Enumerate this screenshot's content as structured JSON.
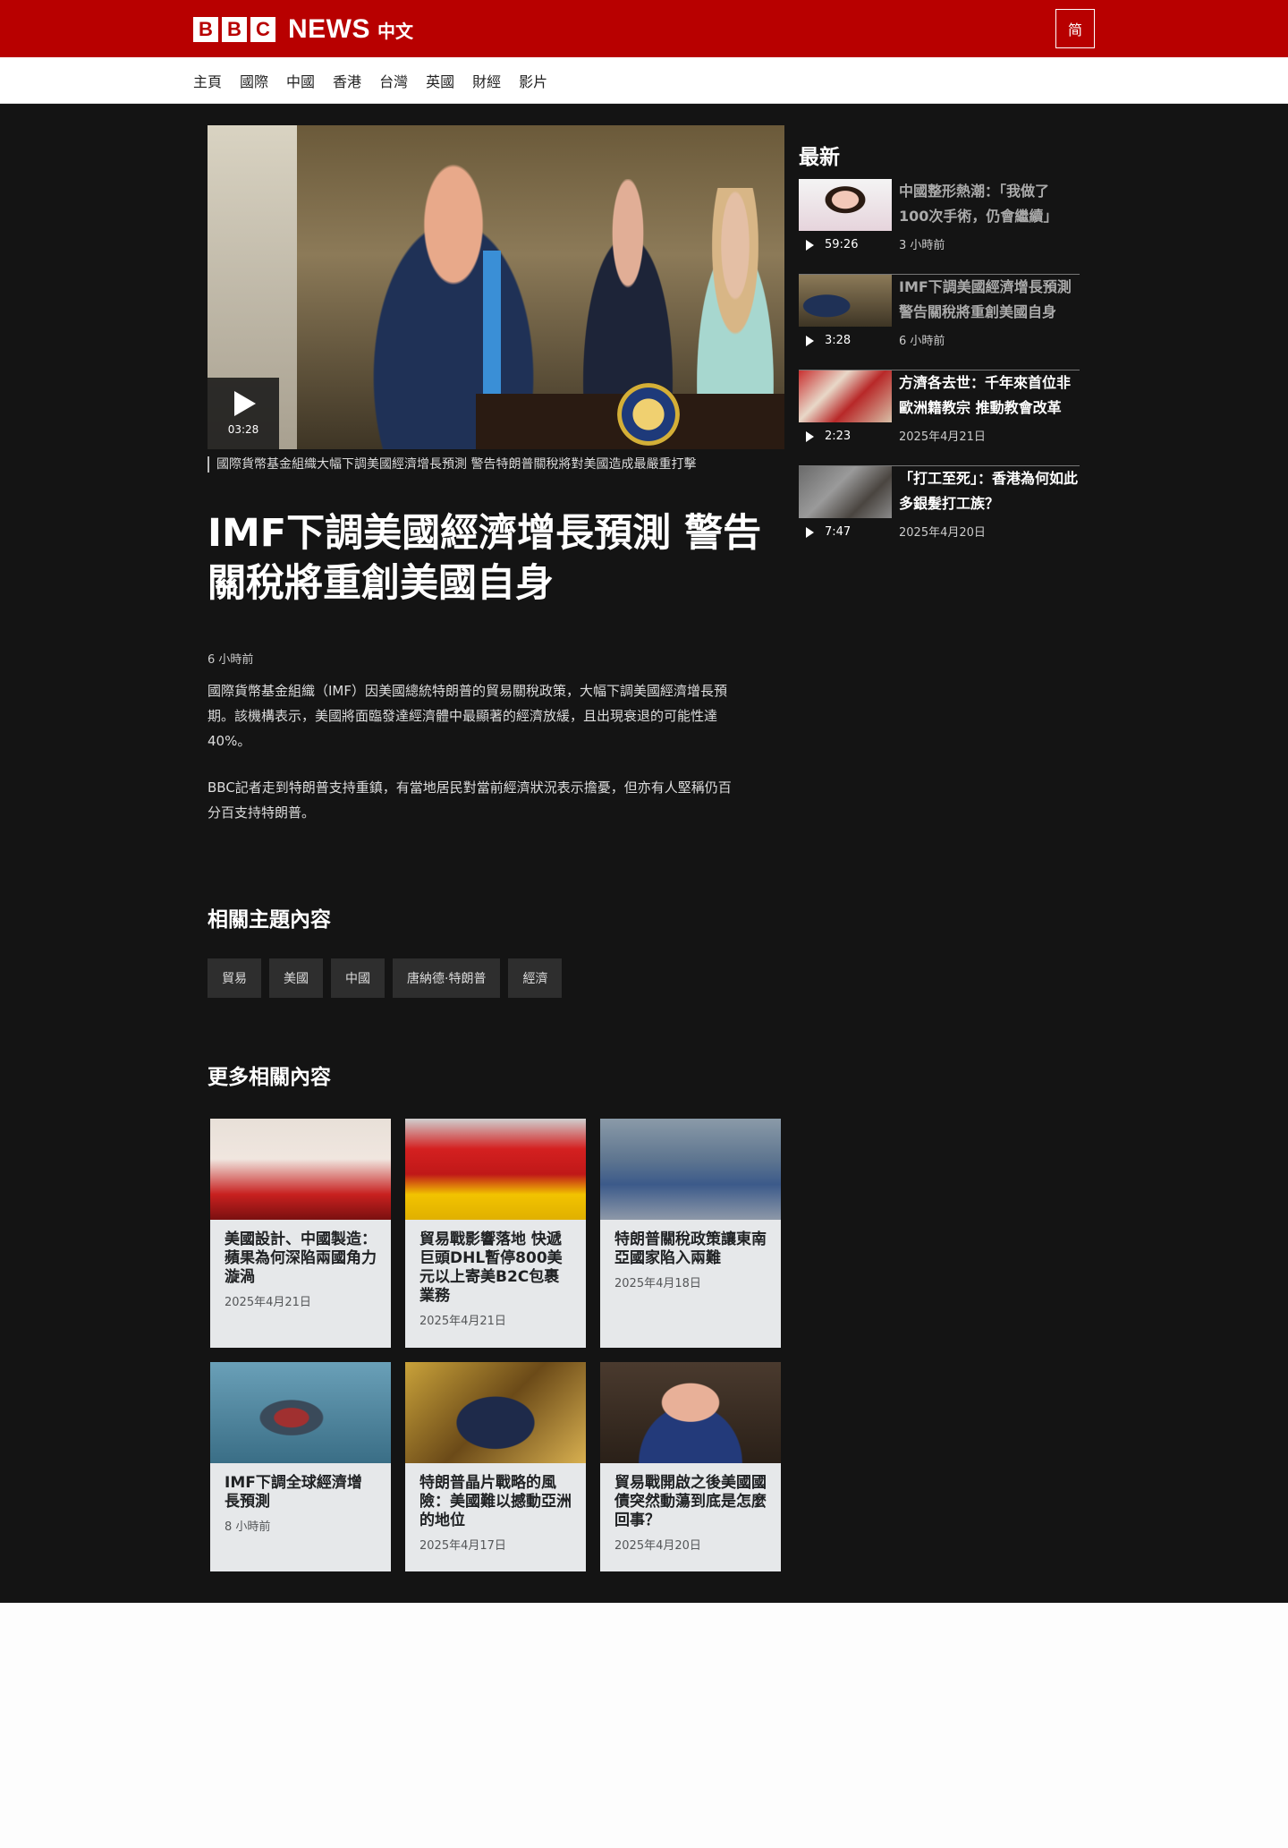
{
  "brand": {
    "logo_letters": [
      "B",
      "B",
      "C"
    ],
    "news_label": "NEWS",
    "lang_label": "中文",
    "script_toggle": "简",
    "color": "#b80000"
  },
  "nav": {
    "items": [
      "主頁",
      "國際",
      "中國",
      "香港",
      "台灣",
      "英國",
      "財經",
      "影片"
    ]
  },
  "hero": {
    "duration": "03:28",
    "caption": "國際貨幣基金組織大幅下調美國經濟增長預測 警告特朗普關稅將對美國造成最嚴重打擊",
    "icon": "play-icon"
  },
  "article": {
    "headline": "IMF下調美國經濟增長預測 警告關稅將重創美國自身",
    "timestamp": "6 小時前",
    "paragraph1": "國際貨幣基金組織（IMF）因美國總統特朗普的貿易關稅政策，大幅下調美國經濟增長預期。該機構表示，美國將面臨發達經濟體中最顯著的經濟放緩，且出現衰退的可能性達40%。",
    "paragraph2": "BBC記者走到特朗普支持重鎮，有當地居民對當前經濟狀況表示擔憂，但亦有人堅稱仍百分百支持特朗普。"
  },
  "related": {
    "title": "相關主題內容",
    "tags": [
      "貿易",
      "美國",
      "中國",
      "唐納德·特朗普",
      "經濟"
    ]
  },
  "more": {
    "title": "更多相關內容",
    "cards": [
      {
        "title": "美國設計、中國製造：蘋果為何深陷兩國角力漩渦",
        "date": "2025年4月21日"
      },
      {
        "title": "貿易戰影響落地 快遞巨頭DHL暫停800美元以上寄美B2C包裹業務",
        "date": "2025年4月21日"
      },
      {
        "title": "特朗普關稅政策讓東南亞國家陷入兩難",
        "date": "2025年4月18日"
      },
      {
        "title": "IMF下調全球經濟增長預測",
        "date": "8 小時前"
      },
      {
        "title": "特朗普晶片戰略的風險：美國難以撼動亞洲的地位",
        "date": "2025年4月17日"
      },
      {
        "title": "貿易戰開啟之後美國國債突然動蕩到底是怎麼回事？",
        "date": "2025年4月20日"
      }
    ]
  },
  "latest": {
    "title": "最新",
    "items": [
      {
        "title": "中國整形熱潮：「我做了100次手術，仍會繼續」",
        "duration": "59:26",
        "time": "3 小時前",
        "visited": true
      },
      {
        "title": "IMF下調美國經濟增長預測 警告關稅將重創美國自身",
        "duration": "3:28",
        "time": "6 小時前",
        "visited": true
      },
      {
        "title": "方濟各去世：千年來首位非歐洲籍教宗 推動教會改革",
        "duration": "2:23",
        "time": "2025年4月21日",
        "visited": false
      },
      {
        "title": "「打工至死」：香港為何如此多銀髮打工族？",
        "duration": "7:47",
        "time": "2025年4月20日",
        "visited": false
      }
    ]
  }
}
